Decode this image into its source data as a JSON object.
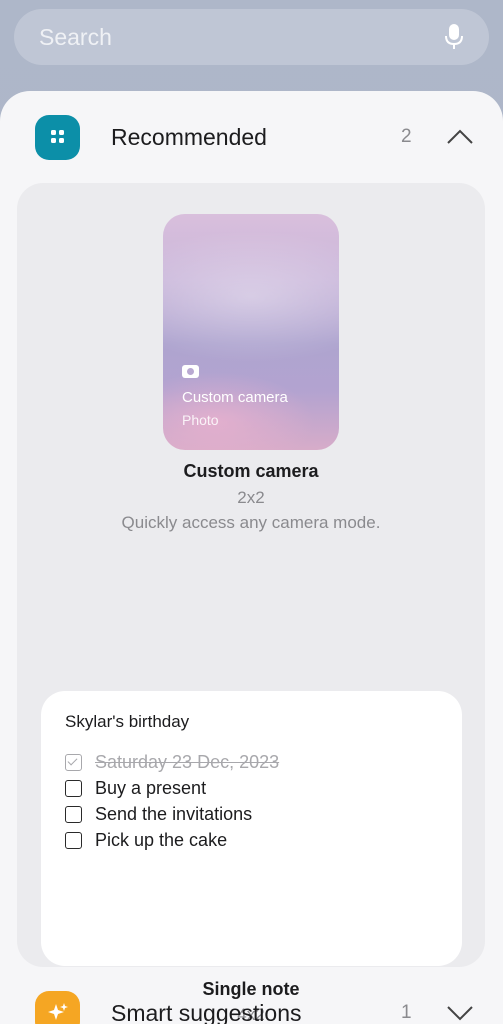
{
  "search": {
    "placeholder": "Search",
    "mic_icon": "mic-icon"
  },
  "recommended": {
    "title": "Recommended",
    "count": "2",
    "icon": "widgets-grid-icon",
    "icon_color": "#0c8fa8",
    "expanded": true
  },
  "camera_widget": {
    "preview_title": "Custom camera",
    "preview_subtitle": "Photo",
    "name": "Custom camera",
    "size": "2x2",
    "description": "Quickly access any camera mode."
  },
  "note_widget": {
    "note_title": "Skylar's birthday",
    "items": [
      {
        "text": "Saturday 23 Dec, 2023",
        "checked": true
      },
      {
        "text": "Buy a present",
        "checked": false
      },
      {
        "text": "Send the invitations",
        "checked": false
      },
      {
        "text": "Pick up the cake",
        "checked": false
      }
    ],
    "name": "Single note",
    "size": "4x2"
  },
  "smart_suggestions": {
    "title": "Smart suggestions",
    "count": "1",
    "icon": "sparkle-icon",
    "icon_color": "#f5a623",
    "expanded": false
  }
}
